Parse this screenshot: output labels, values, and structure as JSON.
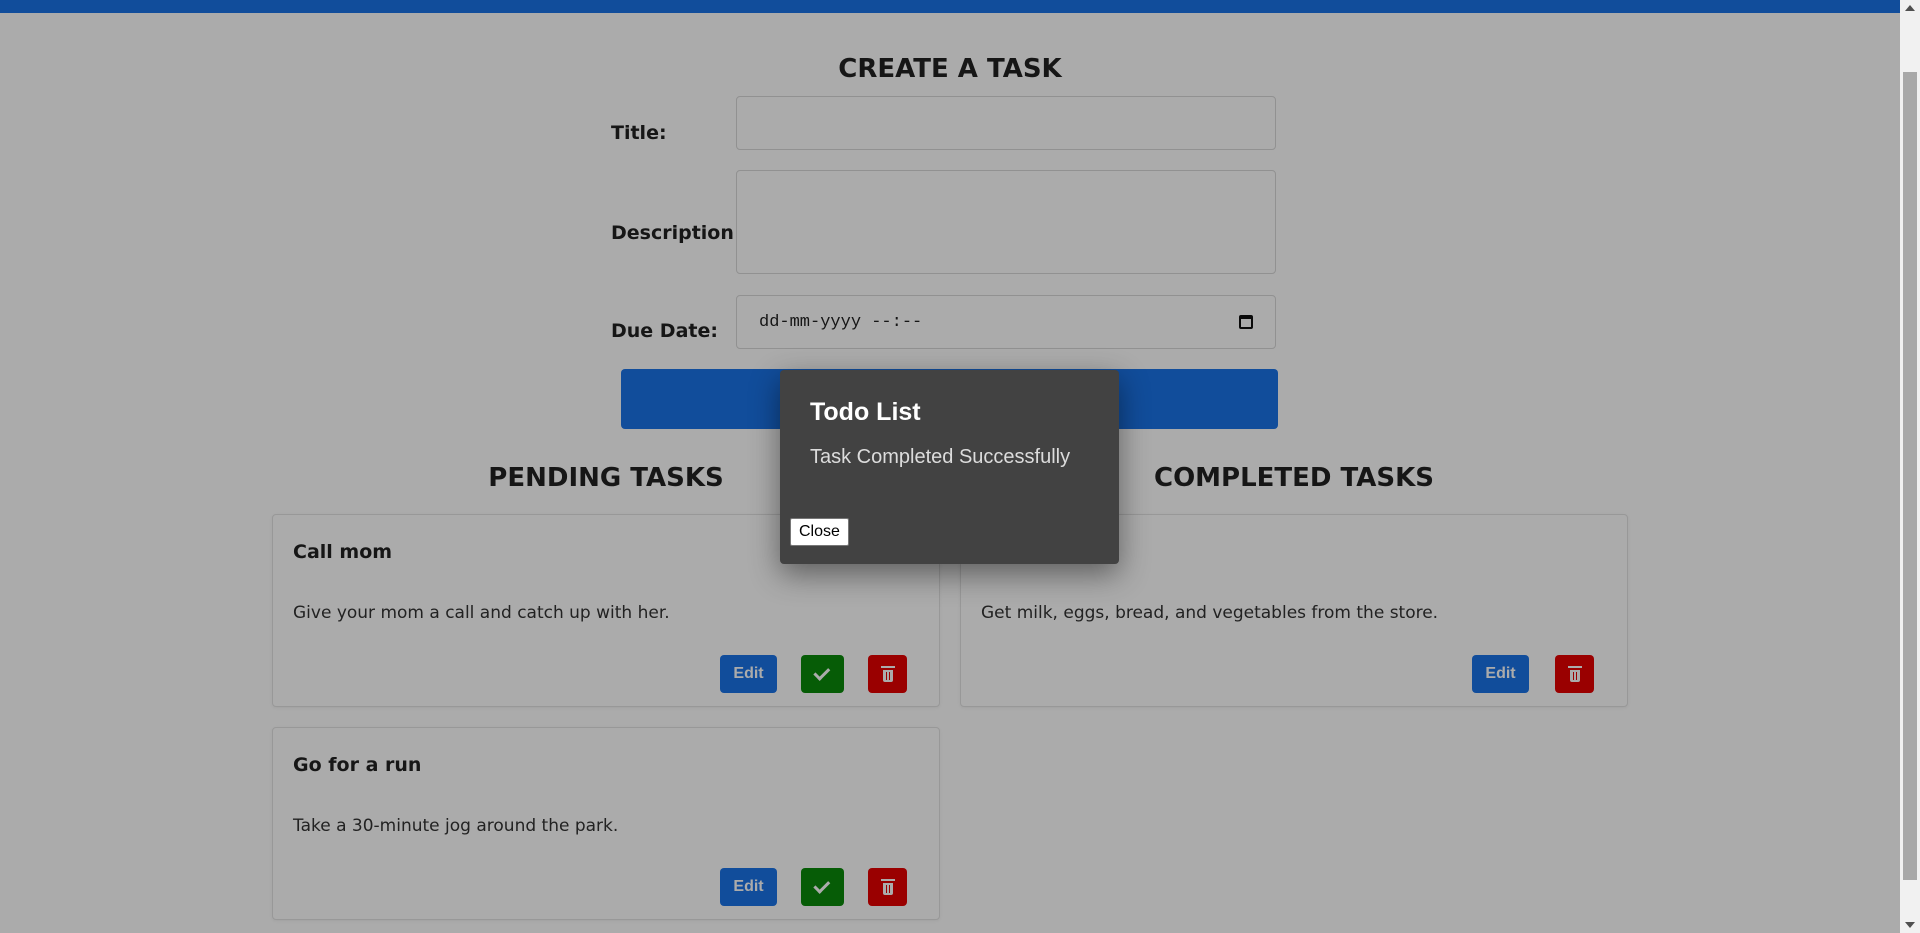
{
  "colors": {
    "accent": "#1a73e8",
    "complete": "#0a8a0a",
    "delete": "#e60000",
    "dialog_bg": "#424242"
  },
  "create": {
    "heading": "CREATE A TASK",
    "title_label": "Title:",
    "title_value": "",
    "description_label": "Description:",
    "description_value": "",
    "due_label": "Due Date:",
    "due_placeholder": "dd-mm-yyyy --:--",
    "due_icon": "calendar-icon",
    "submit_label": ""
  },
  "pending": {
    "heading": "PENDING TASKS",
    "tasks": [
      {
        "title": "Call mom",
        "description": "Give your mom a call and catch up with her.",
        "edit_label": "Edit",
        "complete_icon": "check-icon",
        "delete_icon": "trash-icon"
      },
      {
        "title": "Go for a run",
        "description": "Take a 30-minute jog around the park.",
        "edit_label": "Edit",
        "complete_icon": "check-icon",
        "delete_icon": "trash-icon"
      }
    ]
  },
  "completed": {
    "heading": "COMPLETED TASKS",
    "tasks": [
      {
        "title": "",
        "description": "Get milk, eggs, bread, and vegetables from the store.",
        "edit_label": "Edit",
        "delete_icon": "trash-icon"
      }
    ]
  },
  "dialog": {
    "title": "Todo List",
    "message": "Task Completed Successfully",
    "close_label": "Close"
  }
}
